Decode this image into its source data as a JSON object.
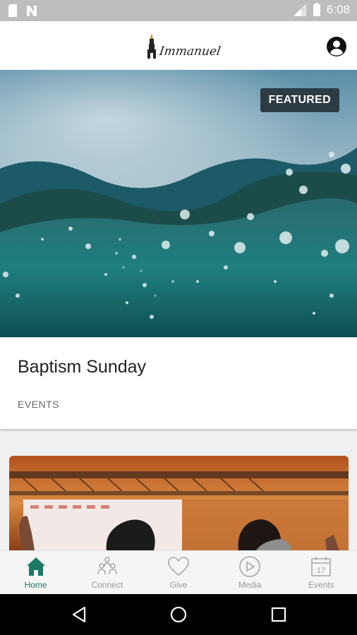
{
  "status_bar": {
    "time": "6:08",
    "icons": [
      "sd-card-icon",
      "n-icon",
      "signal-icon",
      "battery-icon"
    ]
  },
  "app_bar": {
    "logo_text": "Immanuel",
    "profile_icon": "account-circle-icon"
  },
  "featured": {
    "badge": "FEATURED",
    "title": "Baptism Sunday",
    "category": "EVENTS"
  },
  "bottom_nav": {
    "items": [
      {
        "label": "Home",
        "icon": "home-icon",
        "active": true
      },
      {
        "label": "Connect",
        "icon": "people-icon",
        "active": false
      },
      {
        "label": "Give",
        "icon": "heart-icon",
        "active": false
      },
      {
        "label": "Media",
        "icon": "play-circle-icon",
        "active": false
      },
      {
        "label": "Events",
        "icon": "calendar-icon",
        "calendar_day": "17",
        "active": false
      }
    ]
  },
  "system_nav": {
    "icons": [
      "back-icon",
      "home-circle-icon",
      "recents-icon"
    ]
  },
  "colors": {
    "accent": "#1b7a63",
    "badge_bg": "#2d3b45",
    "statusbar": "#bdbdbd"
  }
}
